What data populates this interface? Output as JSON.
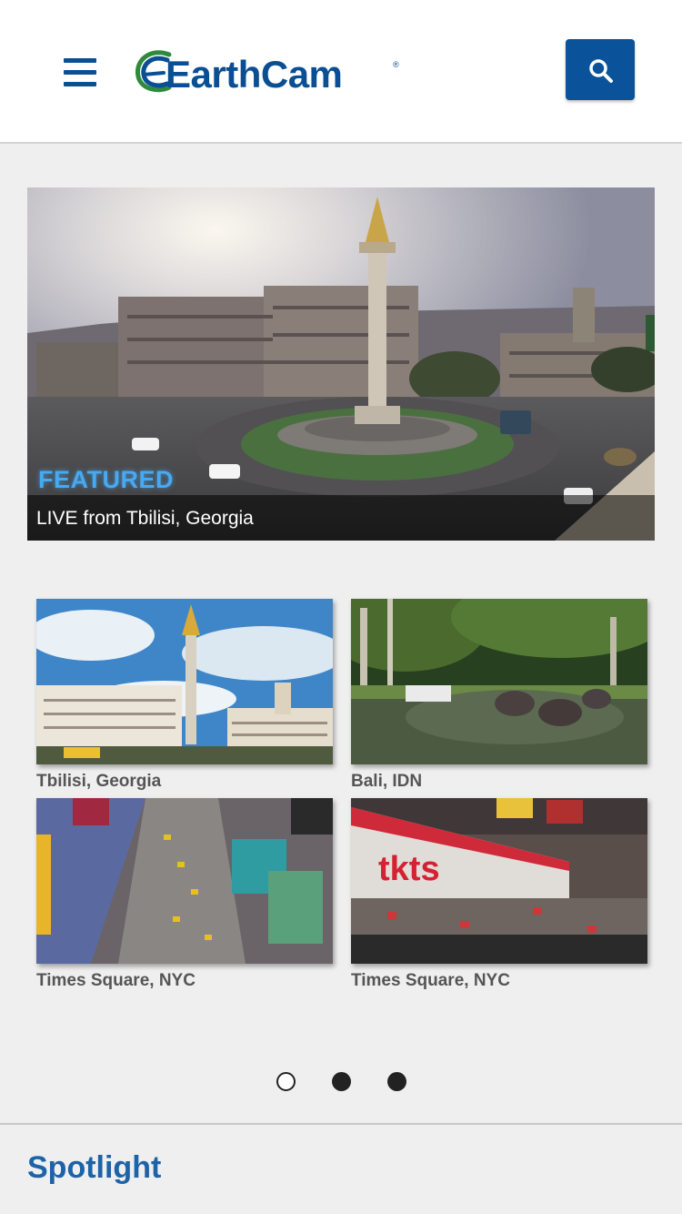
{
  "header": {
    "brand_name": "EarthCam",
    "brand_registered": "®",
    "menu_icon": "hamburger-menu-icon",
    "search_icon": "search-icon",
    "accent_color": "#0a4e94"
  },
  "featured": {
    "tag": "FEATURED",
    "caption": "LIVE from Tbilisi, Georgia"
  },
  "tiles": [
    {
      "label": "Tbilisi, Georgia"
    },
    {
      "label": "Bali, IDN"
    },
    {
      "label": "Times Square, NYC"
    },
    {
      "label": "Times Square, NYC"
    }
  ],
  "carousel": {
    "pages": 3,
    "active_page": 1
  },
  "spotlight": {
    "title": "Spotlight"
  }
}
